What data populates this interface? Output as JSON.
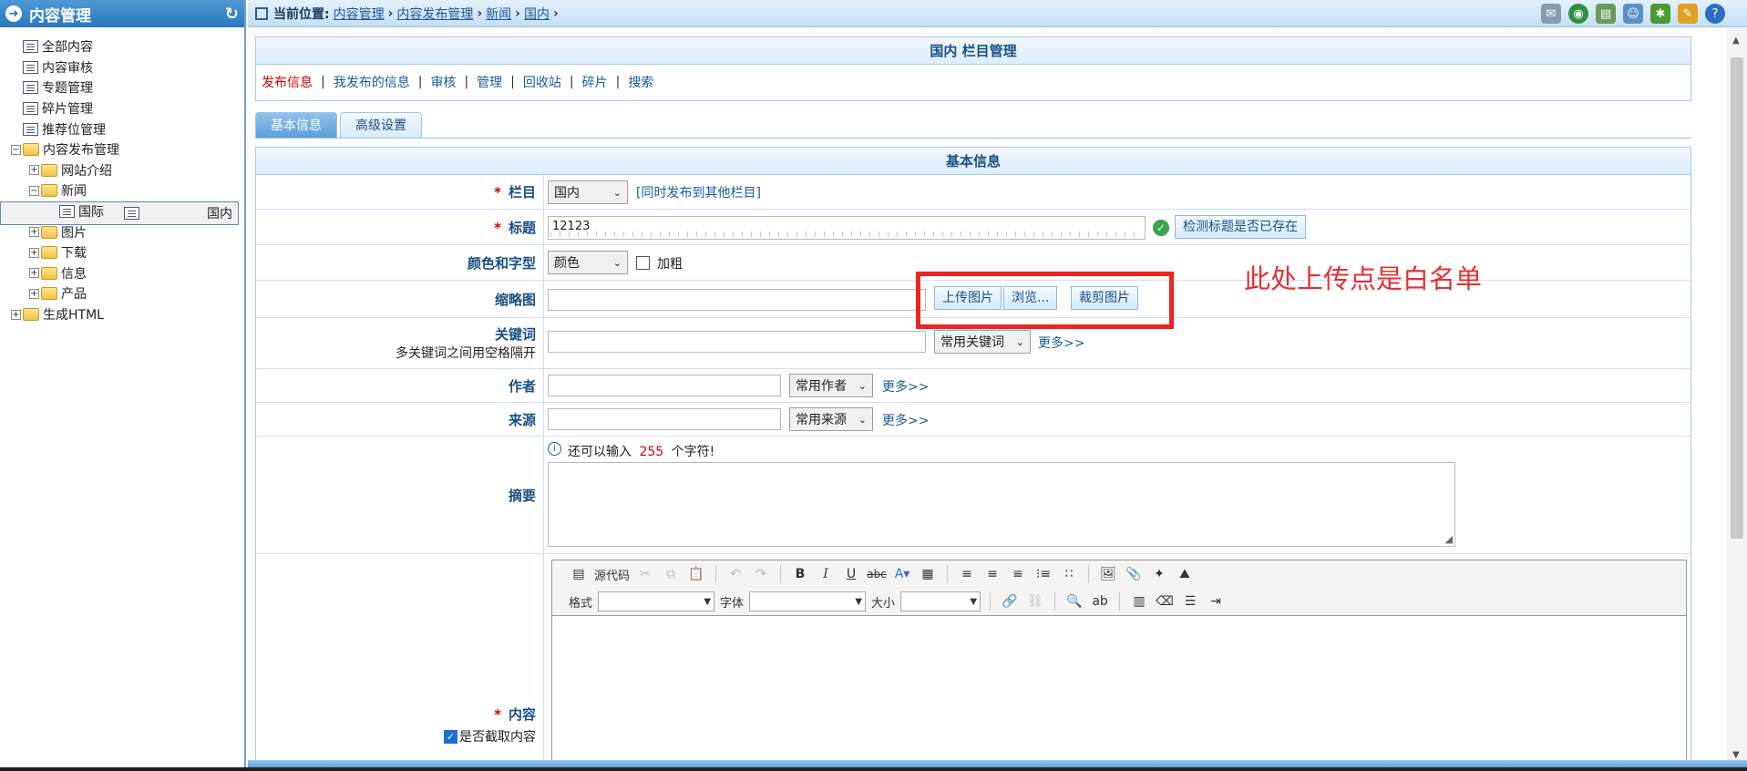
{
  "sidebar": {
    "title": "内容管理",
    "items": [
      {
        "label": "全部内容",
        "indent": 0,
        "icon": "doc",
        "toggle": ""
      },
      {
        "label": "内容审核",
        "indent": 0,
        "icon": "doc",
        "toggle": ""
      },
      {
        "label": "专题管理",
        "indent": 0,
        "icon": "doc",
        "toggle": ""
      },
      {
        "label": "碎片管理",
        "indent": 0,
        "icon": "doc",
        "toggle": ""
      },
      {
        "label": "推荐位管理",
        "indent": 0,
        "icon": "doc",
        "toggle": ""
      },
      {
        "label": "内容发布管理",
        "indent": 0,
        "icon": "folder",
        "toggle": "−"
      },
      {
        "label": "网站介绍",
        "indent": 1,
        "icon": "folder",
        "toggle": "+"
      },
      {
        "label": "新闻",
        "indent": 1,
        "icon": "folder",
        "toggle": "−"
      },
      {
        "label": "国内",
        "indent": 2,
        "icon": "doc",
        "toggle": "",
        "selected": true
      },
      {
        "label": "国际",
        "indent": 2,
        "icon": "doc",
        "toggle": ""
      },
      {
        "label": "图片",
        "indent": 1,
        "icon": "folder",
        "toggle": "+"
      },
      {
        "label": "下载",
        "indent": 1,
        "icon": "folder",
        "toggle": "+"
      },
      {
        "label": "信息",
        "indent": 1,
        "icon": "folder",
        "toggle": "+"
      },
      {
        "label": "产品",
        "indent": 1,
        "icon": "folder",
        "toggle": "+"
      },
      {
        "label": "生成HTML",
        "indent": 0,
        "icon": "folder",
        "toggle": "+"
      }
    ]
  },
  "topbar": {
    "location_label": "当前位置:",
    "crumbs": [
      "内容管理",
      "内容发布管理",
      "新闻",
      "国内"
    ]
  },
  "panel": {
    "title": "国内 栏目管理",
    "links": [
      "发布信息",
      "我发布的信息",
      "审核",
      "管理",
      "回收站",
      "碎片",
      "搜索"
    ]
  },
  "tabs": [
    "基本信息",
    "高级设置"
  ],
  "form": {
    "title": "基本信息",
    "required_mark": "*",
    "column": {
      "label": "栏目",
      "value": "国内",
      "link": "[同时发布到其他栏目]"
    },
    "title_field": {
      "label": "标题",
      "value": "12123",
      "check_button": "检测标题是否已存在"
    },
    "style": {
      "label": "颜色和字型",
      "color_value": "颜色",
      "bold_label": "加粗"
    },
    "thumb": {
      "label": "缩略图",
      "upload": "上传图片",
      "browse": "浏览...",
      "crop": "裁剪图片"
    },
    "keywords": {
      "label": "关键词",
      "hint": "多关键词之间用空格隔开",
      "select": "常用关键词",
      "more": "更多>>"
    },
    "author": {
      "label": "作者",
      "select": "常用作者",
      "more": "更多>>"
    },
    "source": {
      "label": "来源",
      "select": "常用来源",
      "more": "更多>>"
    },
    "summary": {
      "label": "摘要",
      "tip_prefix": "还可以输入",
      "remaining": "255",
      "tip_suffix": "个字符!"
    },
    "content": {
      "label": "内容",
      "truncate_label": "是否截取内容",
      "source_code": "源代码",
      "format_label": "格式",
      "font_label": "字体",
      "size_label": "大小"
    }
  },
  "annotation": {
    "text": "此处上传点是白名单"
  },
  "colors": {
    "accent": "#2a78c0",
    "link": "#1a5a9a",
    "required": "#d40000",
    "annotation": "#ec2424"
  }
}
